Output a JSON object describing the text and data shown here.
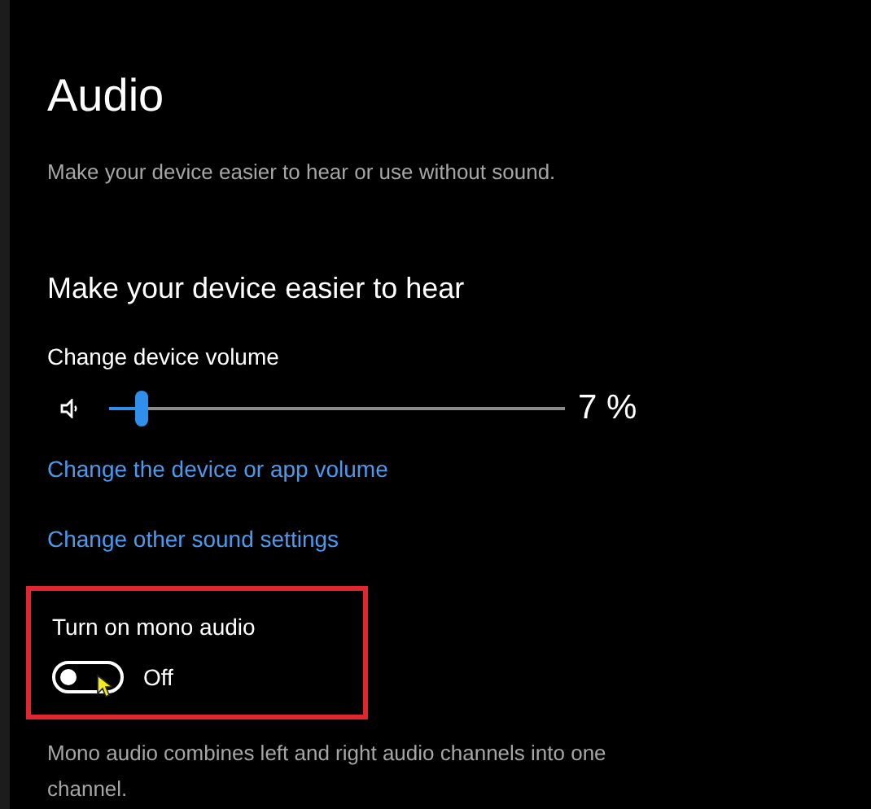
{
  "page": {
    "title": "Audio",
    "description": "Make your device easier to hear or use without sound."
  },
  "section": {
    "heading": "Make your device easier to hear"
  },
  "volume": {
    "label": "Change device volume",
    "level": 0.07,
    "reading": "7 %"
  },
  "links": [
    "Change the device or app volume",
    "Change other sound settings"
  ],
  "mono_audio": {
    "label": "Turn on mono audio",
    "on": false,
    "state_text": "Off",
    "highlighted": true,
    "description": "Mono audio combines left and right audio channels into one channel."
  }
}
